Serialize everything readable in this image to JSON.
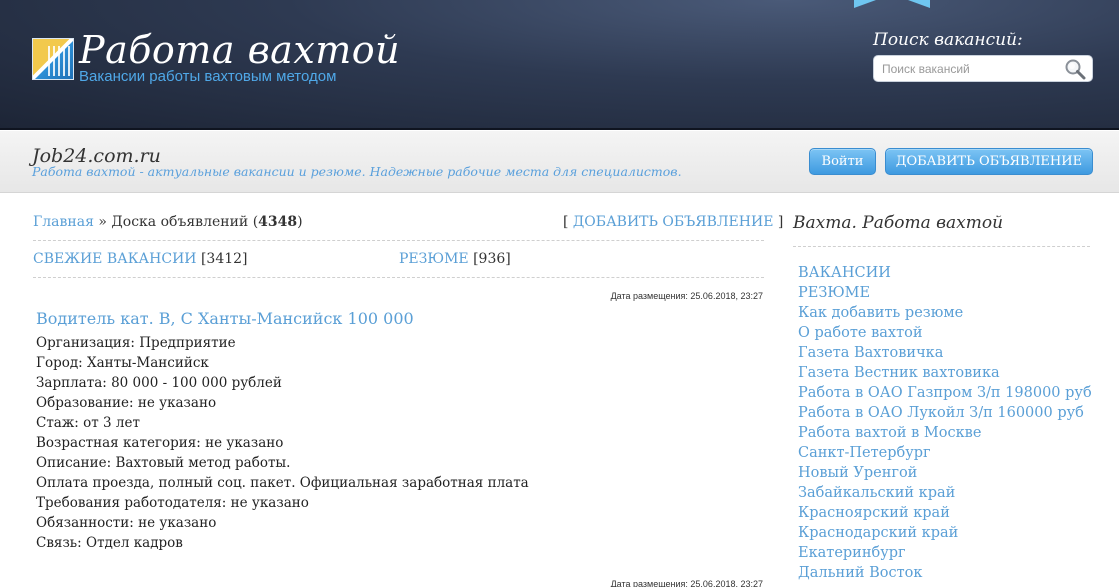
{
  "header": {
    "title": "Работа вахтой",
    "subtitle": "Вакансии работы вахтовым методом",
    "search_label": "Поиск вакансий:",
    "search_placeholder": "Поиск вакансий"
  },
  "band": {
    "site": "Job24.com.ru",
    "tagline": "Работа вахтой - актуальные вакансии и резюме. Надежные рабочие места для специалистов.",
    "login_label": "Войти",
    "add_label": "ДОБАВИТЬ ОБЪЯВЛЕНИЕ"
  },
  "breadcrumb": {
    "home": "Главная",
    "separator": "»",
    "current": "Доска объявлений",
    "count": "4348"
  },
  "add_link": {
    "open": "[",
    "label": "ДОБАВИТЬ ОБЪЯВЛЕНИЕ",
    "close": "]"
  },
  "categories": [
    {
      "label": "СВЕЖИЕ ВАКАНСИИ",
      "count": "[3412]"
    },
    {
      "label": "РЕЗЮМЕ",
      "count": "[936]"
    }
  ],
  "posts": [
    {
      "date": "Дата размещения: 25.06.2018, 23:27",
      "title": "Водитель кат. В, С Ханты-Мансийск 100 000",
      "fields": [
        "Организация: Предприятие",
        "Город: Ханты-Мансийск",
        "Зарплата: 80 000 - 100 000 рублей",
        "Образование: не указано",
        "Стаж: от 3 лет",
        "Возрастная категория: не указано",
        "Описание: Вахтовый метод работы.",
        "Оплата проезда, полный соц. пакет. Официальная заработная плата",
        "Требования работодателя: не указано",
        "Обязанности: не указано",
        "Связь: Отдел кадров"
      ]
    },
    {
      "date": "Дата размещения: 25.06.2018, 23:27"
    }
  ],
  "sidebar": {
    "title": "Вахта. Работа вахтой",
    "items": [
      "ВАКАНСИИ",
      "РЕЗЮМЕ",
      "Как добавить резюме",
      "О работе вахтой",
      "Газета Вахтовичка",
      "Газета Вестник вахтовика",
      "Работа в ОАО Газпром З/п 198000 руб",
      "Работа в ОАО Лукойл З/п 160000 руб",
      "Работа вахтой в Москве",
      "Санкт-Петербург",
      "Новый Уренгой",
      "Забайкальский край",
      "Красноярский край",
      "Краснодарский край",
      "Екатеринбург",
      "Дальний Восток"
    ]
  },
  "colors": {
    "header_bg": "#2e3a52",
    "link": "#5a9fd6",
    "button": "#3e9ae0"
  },
  "icons": {
    "logo": "logo-icon",
    "search": "magnifier-icon",
    "ribbon": "ribbon-icon"
  }
}
